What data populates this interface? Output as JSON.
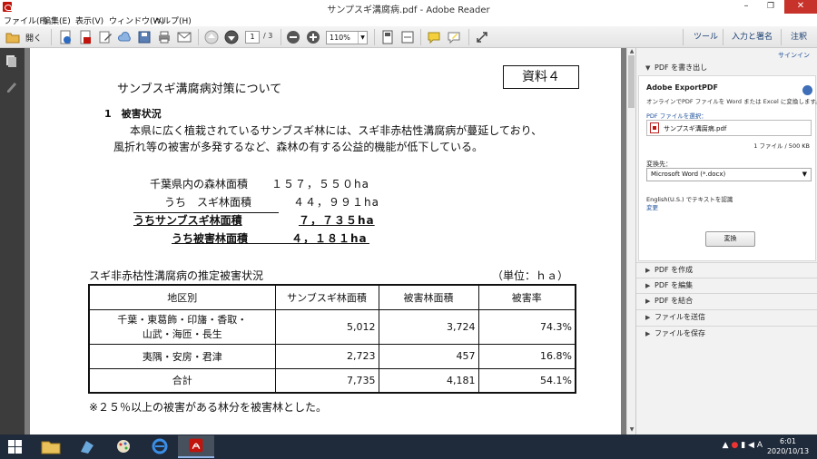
{
  "window": {
    "title": "サンプスギ溝腐病.pdf - Adobe Reader",
    "minimize": "–",
    "maximize": "❐",
    "close": "✕"
  },
  "menu": [
    "ファイル(F)",
    "編集(E)",
    "表示(V)",
    "ウィンドウ(W)",
    "ヘルプ(H)"
  ],
  "toolbar": {
    "open_label": "開く",
    "page_current": "1",
    "page_total": "/ 3",
    "zoom": "110%",
    "right_tabs": [
      "ツール",
      "入力と署名",
      "注釈"
    ]
  },
  "document": {
    "title": "サンブスギ溝腐病対策について",
    "badge": "資料４",
    "section": "1　被害状況",
    "para1": "本県に広く植栽されているサンブスギ林には、スギ非赤枯性溝腐病が蔓延しており、",
    "para2": "風折れ等の被害が多発するなど、森林の有する公益的機能が低下している。",
    "stats": [
      {
        "label": "千葉県内の森林面積",
        "value": "１５７，５５０ha"
      },
      {
        "label": "うち　スギ林面積",
        "value": "４４，９９１ha"
      },
      {
        "label": "うちサンブスギ林面積",
        "value": "７，７３５ha"
      },
      {
        "label": "うち被害林面積",
        "value": "４，１８１ha"
      }
    ],
    "table_caption": "スギ非赤枯性溝腐病の推定被害状況",
    "table_unit": "（単位：ｈａ）",
    "table": {
      "headers": [
        "地区別",
        "サンブスギ林面積",
        "被害林面積",
        "被害率"
      ],
      "rows": [
        {
          "region_line1": "千葉・東葛飾・印旛・香取・",
          "region_line2": "山武・海匝・長生",
          "area": "5,012",
          "damaged": "3,724",
          "rate": "74.3%"
        },
        {
          "region_line1": "夷隅・安房・君津",
          "region_line2": "",
          "area": "2,723",
          "damaged": "457",
          "rate": "16.8%"
        },
        {
          "region_line1": "合計",
          "region_line2": "",
          "area": "7,735",
          "damaged": "4,181",
          "rate": "54.1%"
        }
      ]
    },
    "footnote": "※２５％以上の被害がある林分を被害林とした。"
  },
  "right_pane": {
    "signin": "サインイン",
    "export_header": "PDF を書き出し",
    "product": "Adobe ExportPDF",
    "description": "オンラインでPDF ファイルを Word または Excel に変換します。",
    "select_file_label": "PDF ファイルを選択：",
    "file_name": "サンプスギ溝腐病.pdf",
    "file_count": "1 ファイル / 500 KB",
    "convert_to_label": "変換先：",
    "format": "Microsoft Word (*.docx)",
    "ocr_text": "English(U.S.) でテキストを認識",
    "change_link": "変更",
    "convert_button": "変換",
    "panels": [
      "PDF を作成",
      "PDF を編集",
      "PDF を結合",
      "ファイルを送信",
      "ファイルを保存"
    ]
  },
  "taskbar": {
    "ime": "A",
    "time": "6:01",
    "date": "2020/10/13"
  },
  "colors": {
    "accent": "#1a3f73",
    "close": "#c7322a",
    "taskbar": "#1f2a3a",
    "nav": "#3c3c3c"
  }
}
